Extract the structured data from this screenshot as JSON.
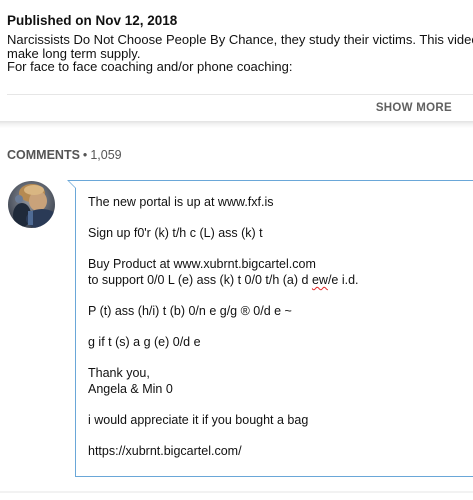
{
  "video": {
    "published": "Published on Nov 12, 2018",
    "description_lines": [
      "Narcissists Do Not Choose People By Chance, they study their victims. This video will hel",
      "make long term supply.",
      "For face to face coaching and/or phone coaching:"
    ],
    "show_more_label": "SHOW MORE"
  },
  "comments": {
    "label": "COMMENTS",
    "separator": "•",
    "count": "1,059"
  },
  "draft_comment": {
    "avatar_icon": "user-avatar-photo",
    "accent_color": "#6aa7d8",
    "paragraphs": [
      [
        "The new portal is up at www.fxf.is"
      ],
      [
        "Sign up f0'r (k) t/h c (L) ass (k) t"
      ],
      [
        "Buy Product at www.xubrnt.bigcartel.com"
      ],
      [
        "P (t) ass (h/i) t (b) 0/n e g/g ® 0/d e ~"
      ],
      [
        "g if t (s) a g (e) 0/d e"
      ],
      [
        "Thank you,",
        "Angela & Min 0"
      ],
      [
        "i would appreciate it if you bought a bag"
      ],
      [
        "https://xubrnt.bigcartel.com/"
      ]
    ],
    "support_line": {
      "prefix": "to support 0/0 L (e) ass (k) t 0/0 t/h (a) d ",
      "misspelled": "ew",
      "suffix": "/e i.d."
    }
  }
}
